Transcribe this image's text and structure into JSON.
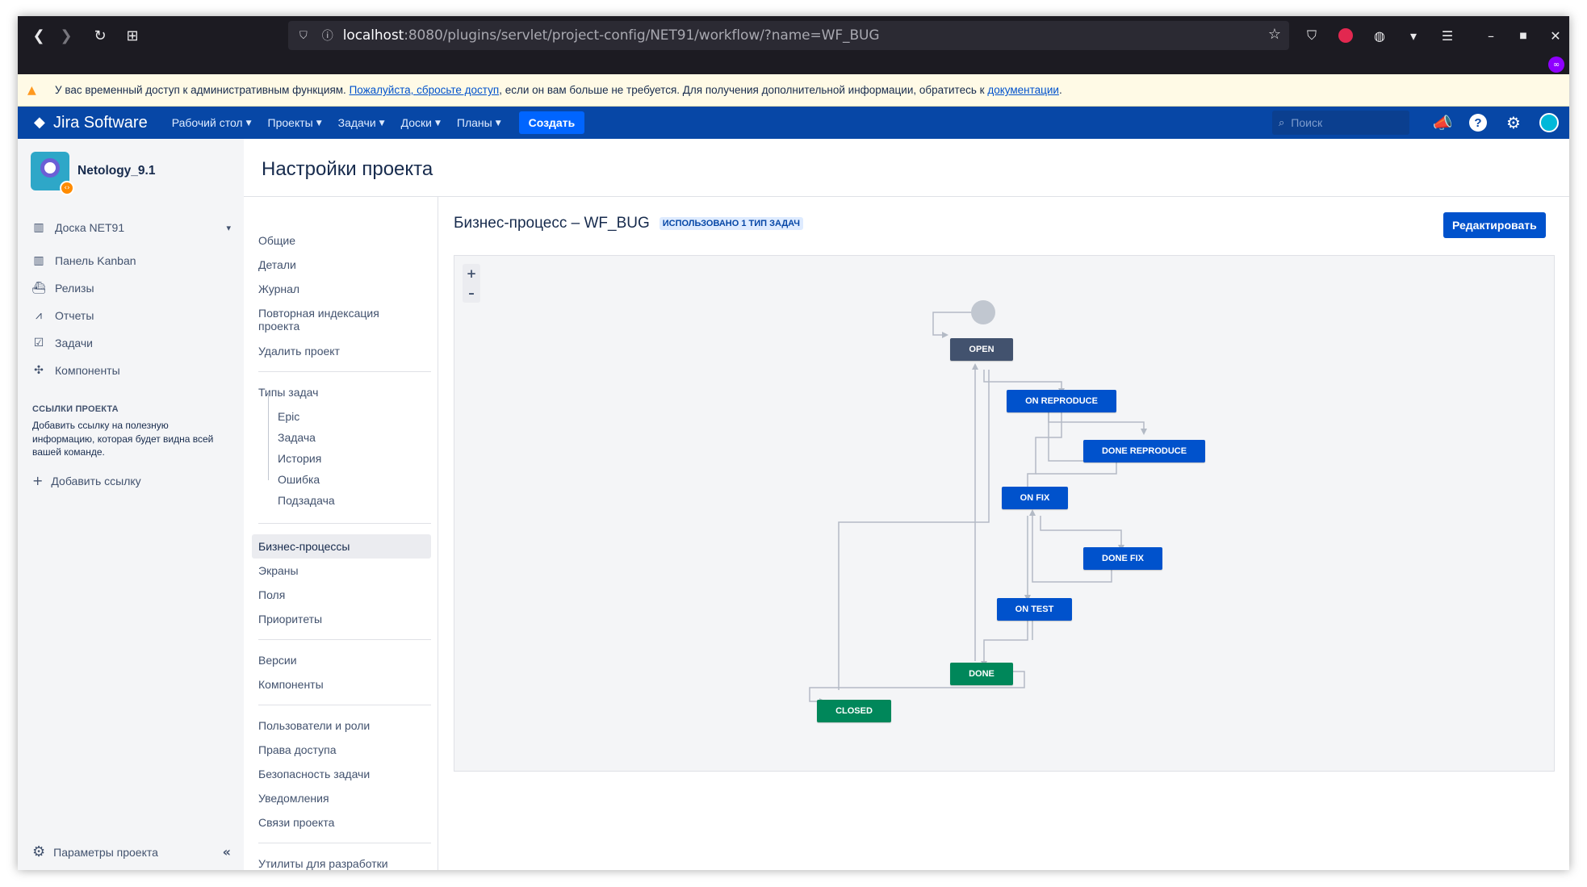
{
  "browser": {
    "url_host": "localhost",
    "url_rest": ":8080/plugins/servlet/project-config/NET91/workflow/?name=WF_BUG"
  },
  "banner": {
    "text_before": "У вас временный доступ к административным функциям.",
    "link1": "Пожалуйста, сбросьте доступ",
    "text_middle": ", если он вам больше не требуется. Для получения дополнительной информации, обратитесь к",
    "link2": "документации",
    "text_end": "."
  },
  "header": {
    "logo": "Jira Software",
    "menu": [
      {
        "label": "Рабочий стол"
      },
      {
        "label": "Проекты"
      },
      {
        "label": "Задачи"
      },
      {
        "label": "Доски"
      },
      {
        "label": "Планы"
      }
    ],
    "create": "Создать",
    "search_placeholder": "Поиск"
  },
  "sidebar": {
    "project_name": "Netology_9.1",
    "items": [
      {
        "label": "Доска NET91",
        "icon": "board-icon"
      },
      {
        "label": "Панель Kanban",
        "icon": "kanban-icon"
      },
      {
        "label": "Релизы",
        "icon": "ship-icon"
      },
      {
        "label": "Отчеты",
        "icon": "chart-icon"
      },
      {
        "label": "Задачи",
        "icon": "issues-icon"
      },
      {
        "label": "Компоненты",
        "icon": "puzzle-icon"
      }
    ],
    "links_heading": "ССЫЛКИ ПРОЕКТА",
    "links_note": "Добавить ссылку на полезную информацию, которая будет видна всей вашей команде.",
    "add_link": "Добавить ссылку",
    "settings": "Параметры проекта"
  },
  "page_title": "Настройки проекта",
  "settings_nav": {
    "general": [
      "Общие",
      "Детали",
      "Журнал",
      "Повторная индексация проекта",
      "Удалить проект"
    ],
    "issue_types_heading": "Типы задач",
    "issue_types": [
      "Epic",
      "Задача",
      "История",
      "Ошибка",
      "Подзадача"
    ],
    "schemes": [
      "Бизнес-процессы",
      "Экраны",
      "Поля",
      "Приоритеты"
    ],
    "versions": [
      "Версии",
      "Компоненты"
    ],
    "access": [
      "Пользователи и роли",
      "Права доступа",
      "Безопасность задачи",
      "Уведомления",
      "Связи проекта"
    ],
    "dev": "Утилиты для разработки"
  },
  "workflow": {
    "title": "Бизнес-процесс – WF_BUG",
    "lozenge": "ИСПОЛЬЗОВАНО 1 ТИП ЗАДАЧ",
    "edit": "Редактировать",
    "zoom_in": "+",
    "zoom_out": "–",
    "statuses": {
      "open": "OPEN",
      "on_reproduce": "ON REPRODUCE",
      "done_reproduce": "DONE REPRODUCE",
      "on_fix": "ON FIX",
      "done_fix": "DONE FIX",
      "on_test": "ON TEST",
      "done": "DONE",
      "closed": "CLOSED"
    },
    "colors": {
      "todo": "#42526e",
      "in_progress": "#0052cc",
      "done": "#00875a"
    }
  }
}
